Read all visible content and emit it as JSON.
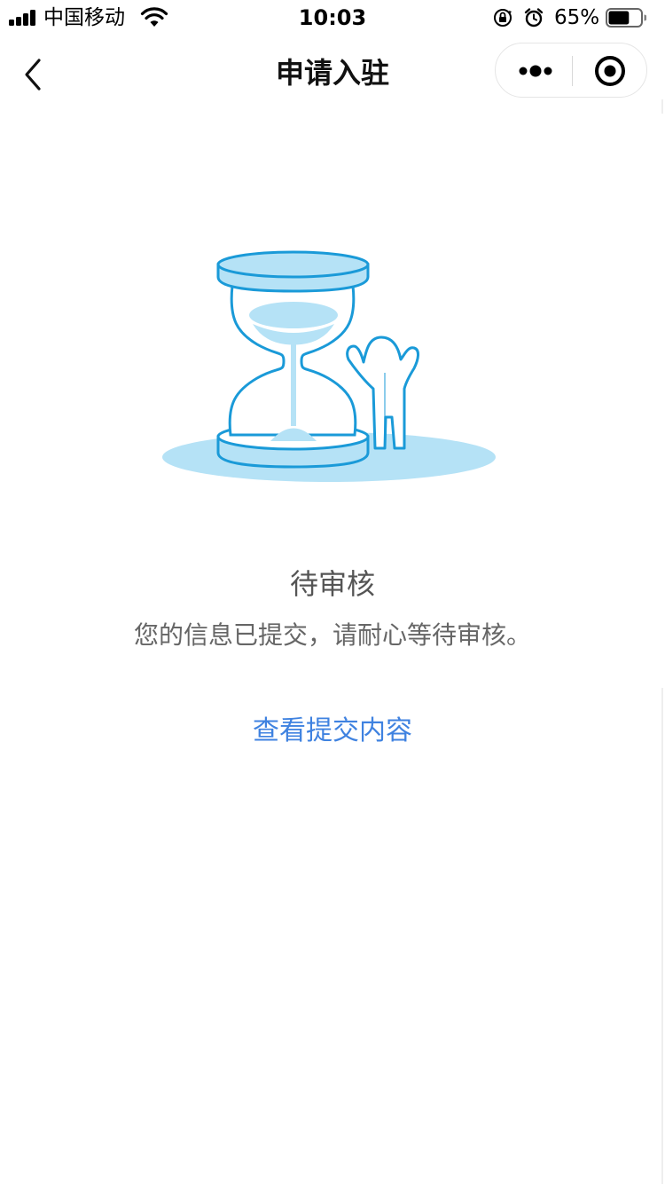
{
  "status_bar": {
    "carrier": "中国移动",
    "time": "10:03",
    "battery_percent": "65%",
    "battery_level": 0.65
  },
  "nav": {
    "title": "申请入驻"
  },
  "content": {
    "status_title": "待审核",
    "status_description": "您的信息已提交，请耐心等待审核。",
    "view_link": "查看提交内容"
  },
  "colors": {
    "link": "#3f82e0",
    "illustration_fill": "#b5e2f6",
    "illustration_stroke": "#1a9ad8"
  },
  "icons": {
    "back": "chevron-left-icon",
    "more": "more-dots-icon",
    "close": "target-close-icon",
    "wifi": "wifi-icon",
    "signal": "signal-icon",
    "lock": "rotation-lock-icon",
    "alarm": "alarm-icon",
    "battery": "battery-icon"
  }
}
